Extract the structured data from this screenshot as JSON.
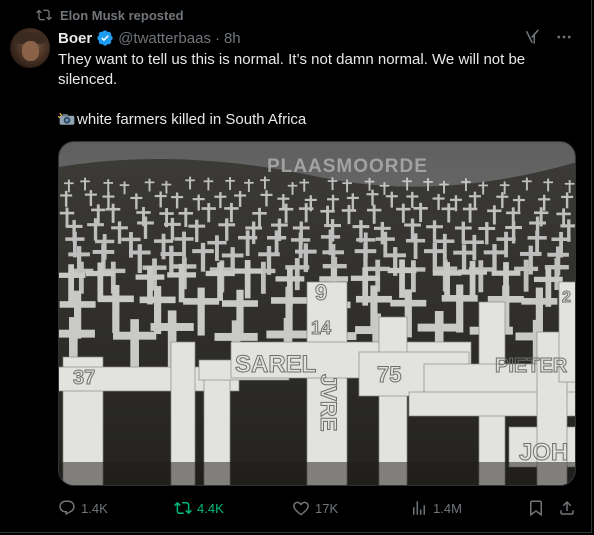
{
  "repost": {
    "label": "Elon Musk reposted"
  },
  "author": {
    "name": "Boer",
    "handle": "@twatterbaas",
    "separator": "·",
    "time": "8h"
  },
  "post": {
    "line1": "They want to tell us this is normal. It’s not damn normal. We will not be silenced.",
    "line2": "white farmers killed in South Africa"
  },
  "media": {
    "banner": "PLAASMOORDE",
    "cross_labels": [
      "9",
      "14",
      "SAREL",
      "75",
      "37",
      "JVRE",
      "PIETER",
      "JOH",
      "2"
    ]
  },
  "actions": {
    "replies": "1.4K",
    "reposts": "4.4K",
    "likes": "17K",
    "views": "1.4M"
  },
  "colors": {
    "background": "#000000",
    "text": "#e7e9ea",
    "muted": "#71767b",
    "verified": "#1d9bf0",
    "repost_active": "#00ba7c"
  },
  "icons": [
    "repost-icon",
    "verified-badge-icon",
    "grok-icon",
    "more-icon",
    "camera-flash-icon",
    "reply-icon",
    "like-icon",
    "views-icon",
    "bookmark-icon",
    "share-icon"
  ]
}
